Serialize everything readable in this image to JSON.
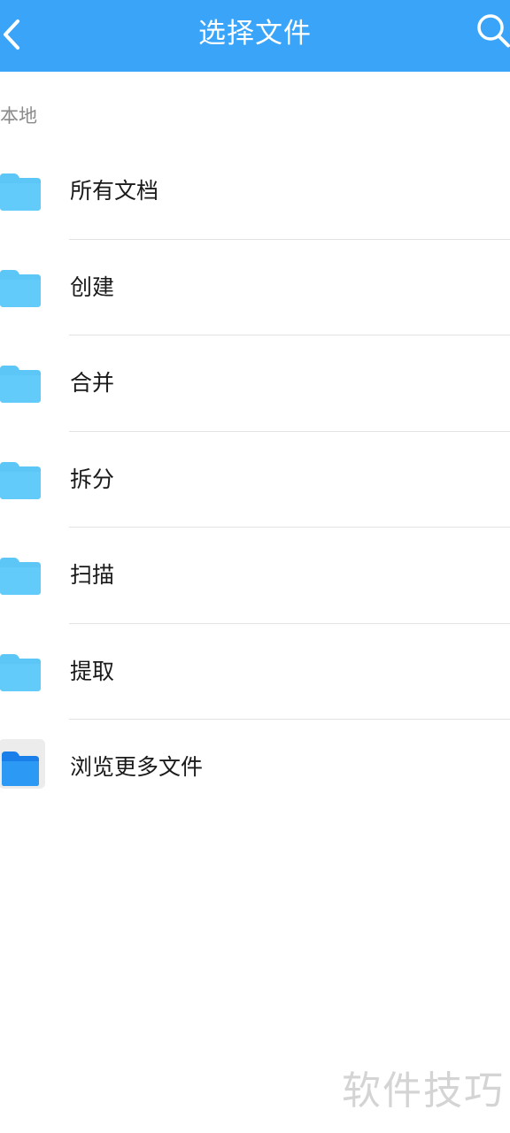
{
  "header": {
    "title": "选择文件",
    "back_icon": "chevron-left-icon",
    "search_icon": "search-icon",
    "background": "#3aa5f8"
  },
  "section": {
    "label": "本地"
  },
  "items": [
    {
      "label": "所有文档",
      "icon": "folder-icon"
    },
    {
      "label": "创建",
      "icon": "folder-icon"
    },
    {
      "label": "合并",
      "icon": "folder-icon"
    },
    {
      "label": "拆分",
      "icon": "folder-icon"
    },
    {
      "label": "扫描",
      "icon": "folder-icon"
    },
    {
      "label": "提取",
      "icon": "folder-icon"
    },
    {
      "label": "浏览更多文件",
      "icon": "files-app-folder-icon"
    }
  ],
  "watermark": "软件技巧"
}
